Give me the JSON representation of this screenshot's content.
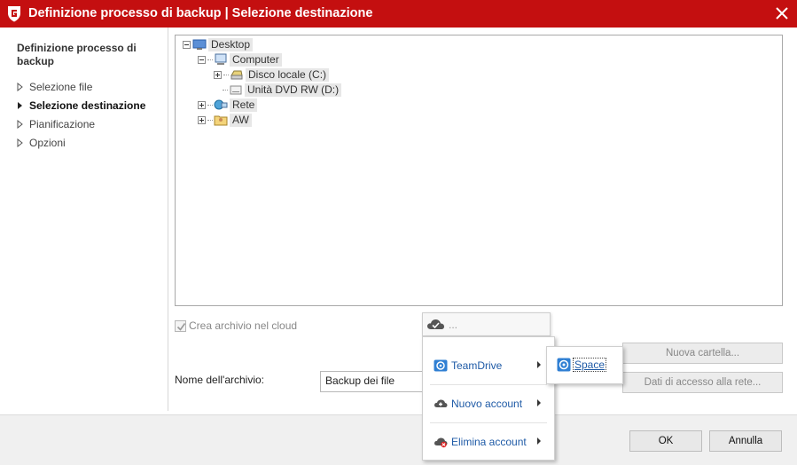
{
  "window": {
    "title": "Definizione processo di backup | Selezione destinazione",
    "accent_color": "#c40f10",
    "logo_icon": "gdata-shield-icon",
    "close_icon": "close-icon"
  },
  "sidebar": {
    "section_title": "Definizione processo di backup",
    "items": [
      {
        "label": "Selezione file",
        "active": false
      },
      {
        "label": "Selezione destinazione",
        "active": true
      },
      {
        "label": "Pianificazione",
        "active": false
      },
      {
        "label": "Opzioni",
        "active": false
      }
    ]
  },
  "tree": {
    "desktop": "Desktop",
    "computer": "Computer",
    "local_disk": "Disco locale (C:)",
    "dvd_drive": "Unità DVD RW (D:)",
    "network": "Rete",
    "user": "AW"
  },
  "options": {
    "cloud_archive_label": "Crea archivio nel cloud",
    "cloud_archive_checked": true
  },
  "buttons": {
    "new_folder": "Nuova cartella...",
    "network_access": "Dati di accesso alla rete...",
    "ok": "OK",
    "cancel": "Annulla"
  },
  "archive": {
    "label": "Nome dell'archivio:",
    "value": "Backup dei file"
  },
  "cloud_dropdown": {
    "selected": "..."
  },
  "cloud_menu": {
    "items": [
      {
        "label": "TeamDrive",
        "icon": "teamdrive-icon"
      },
      {
        "label": "Nuovo account",
        "icon": "cloud-add-icon"
      },
      {
        "label": "Elimina account",
        "icon": "cloud-delete-icon"
      }
    ]
  },
  "teamdrive_submenu": {
    "items": [
      {
        "label": "Space",
        "icon": "teamdrive-space-icon"
      }
    ]
  }
}
